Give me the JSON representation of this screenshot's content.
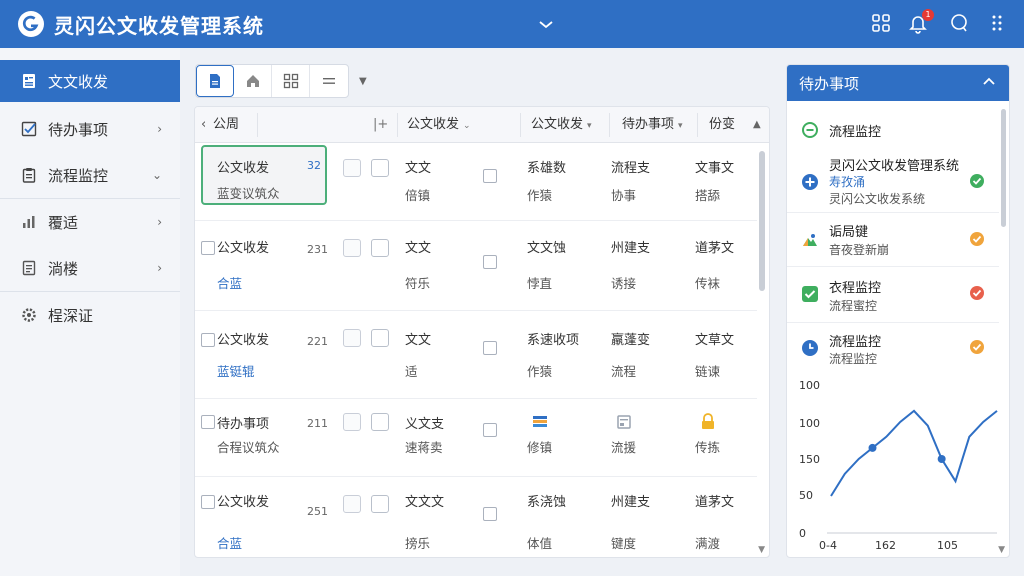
{
  "app": {
    "title": "灵闪公文收发管理系统",
    "notification_count": "1"
  },
  "sidebar": {
    "items": [
      {
        "label": "文文收发",
        "icon": "document-icon",
        "active": true,
        "arrow": ""
      },
      {
        "label": "待办事项",
        "icon": "checklist-icon",
        "arrow": "›"
      },
      {
        "label": "流程监控",
        "icon": "clipboard-icon",
        "arrow": "⌄"
      },
      {
        "label": "覆适",
        "icon": "bar-chart-icon",
        "arrow": "›"
      },
      {
        "label": "淌楼",
        "icon": "file-list-icon",
        "arrow": "›"
      },
      {
        "label": "桯深证",
        "icon": "settings-icon",
        "arrow": ""
      }
    ]
  },
  "table": {
    "headers": {
      "col1": "公周",
      "add": "|+",
      "col2": "公文收发",
      "col3": "公文收发",
      "col4": "待办事项",
      "col5": "份变"
    },
    "rows": [
      {
        "title": "公文收发",
        "sub": "蓝变议筑众",
        "num": "32",
        "c3a": "文文",
        "c3b": "倍镇",
        "c4a": "系雄数",
        "c4b": "作猿",
        "c5a": "流程支",
        "c5b": "协事",
        "c6a": "文事文",
        "c6b": "搭舔"
      },
      {
        "title": "公文收发",
        "sub": "合蓝",
        "num": "231",
        "c3a": "文文",
        "c3b": "符乐",
        "c4a": "文文蚀",
        "c4b": "悖直",
        "c5a": "州建支",
        "c5b": "诱接",
        "c6a": "道茅文",
        "c6b": "传袜"
      },
      {
        "title": "公文收发",
        "sub": "蓝铤辊",
        "num": "221",
        "c3a": "文文",
        "c3b": "适",
        "c4a": "系速收项",
        "c4b": "作猿",
        "c5a": "羸蓬变",
        "c5b": "流程",
        "c6a": "文草文",
        "c6b": "链谏"
      },
      {
        "title": "待办事项",
        "sub": "合程议筑众",
        "num": "211",
        "c3a": "义文支",
        "c3b": "速蒋卖",
        "c4b": "修镇",
        "c5b": "流援",
        "c6b": "传拣"
      },
      {
        "title": "公文收发",
        "sub": "合蓝",
        "num": "251",
        "c3a": "文文文",
        "c3b": "搒乐",
        "c4a": "系浇蚀",
        "c4b": "体值",
        "c5a": "州建支",
        "c5b": "键度",
        "c6a": "道茅文",
        "c6b": "满渡"
      }
    ]
  },
  "todo": {
    "title": "待办事项",
    "items": [
      {
        "title": "流程监控",
        "sub": "",
        "icon": "circle-minus-icon",
        "status": ""
      },
      {
        "title": "灵闪公文收发管理系统",
        "title2": "寿孜涌",
        "sub": "灵闪公文收发系统",
        "icon": "plus-circle-icon",
        "status": "check"
      },
      {
        "title": "诟局键",
        "sub": "音夜登新崩",
        "icon": "image-icon",
        "status": "warn"
      },
      {
        "title": "衣程监控",
        "sub": "流程蜜控",
        "icon": "check-square-icon",
        "status": "alert"
      },
      {
        "title": "流程监控",
        "sub": "流程监控",
        "icon": "clock-icon",
        "status": "warn"
      }
    ]
  },
  "chart_data": {
    "type": "line",
    "x_tick_labels": [
      "0-4",
      "162",
      "105"
    ],
    "y_tick_labels": [
      "100",
      "100",
      "150",
      "50",
      "0"
    ],
    "series": [
      {
        "values": [
          50,
          80,
          100,
          115,
          130,
          150,
          165,
          145,
          100,
          70,
          130,
          150,
          165
        ]
      }
    ],
    "markers_at": [
      3,
      8
    ]
  },
  "colors": {
    "primary": "#2f6fc4",
    "green": "#3fae5f",
    "orange": "#f0a43c",
    "red": "#e8604c"
  }
}
